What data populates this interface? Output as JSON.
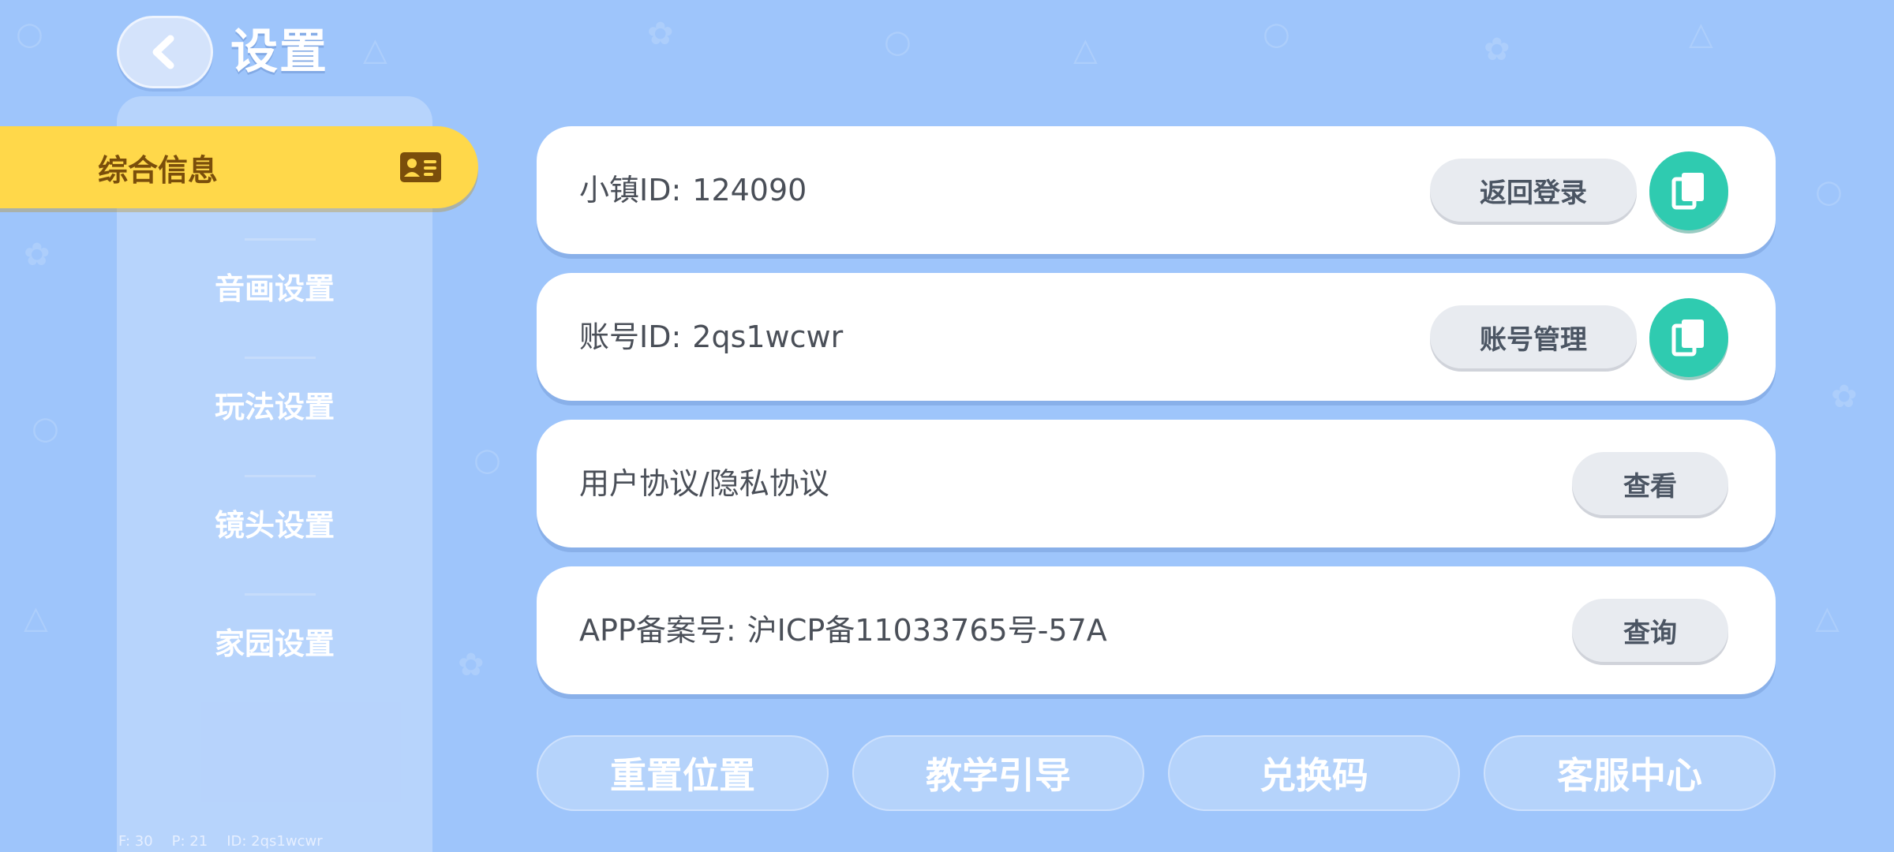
{
  "header": {
    "title": "设置"
  },
  "sidebar": {
    "items": [
      {
        "label": "综合信息",
        "active": true
      },
      {
        "label": "音画设置"
      },
      {
        "label": "玩法设置"
      },
      {
        "label": "镜头设置"
      },
      {
        "label": "家园设置"
      }
    ]
  },
  "main": {
    "cards": [
      {
        "label": "小镇ID:",
        "value": "124090",
        "button": "返回登录"
      },
      {
        "label": "账号ID:",
        "value": "2qs1wcwr",
        "button": "账号管理"
      },
      {
        "label": "用户协议/隐私协议",
        "button": "查看"
      },
      {
        "label": "APP备案号:",
        "value": "沪ICP备11033765号-57A",
        "button": "查询"
      }
    ]
  },
  "bottom_actions": [
    "重置位置",
    "教学引导",
    "兑换码",
    "客服中心"
  ],
  "debug": {
    "f": "F: 30",
    "p": "P: 21",
    "id": "ID: 2qs1wcwr"
  },
  "colors": {
    "background": "#9ec5fb",
    "active_tab": "#ffd84a",
    "copy_button": "#2fcbb0",
    "card": "#ffffff"
  },
  "icons": [
    "back-arrow-icon",
    "id-card-icon",
    "copy-icon"
  ]
}
